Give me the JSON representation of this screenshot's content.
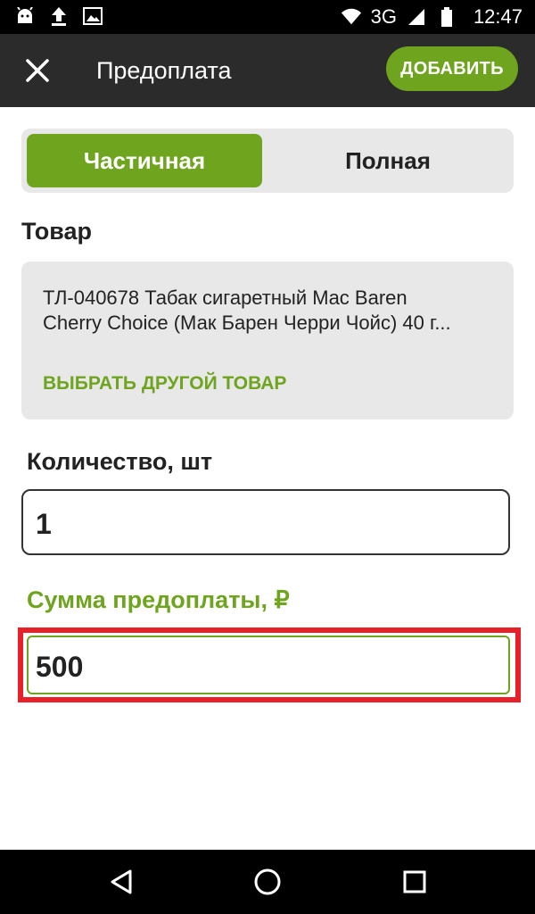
{
  "status_bar": {
    "network": "3G",
    "time": "12:47",
    "icons": [
      "android-icon",
      "upload-icon",
      "image-icon",
      "wifi-icon",
      "signal-icon",
      "battery-icon"
    ]
  },
  "app_bar": {
    "title": "Предоплата",
    "add_label": "ДОБАВИТЬ"
  },
  "segment": {
    "partial_label": "Частичная",
    "full_label": "Полная",
    "selected": "partial"
  },
  "product": {
    "section_label": "Товар",
    "name_line1": "ТЛ-040678 Табак сигаретный Mac Baren",
    "name_line2": "Cherry Choice (Мак Барен Черри Чойс) 40 г...",
    "choose_other_label": "ВЫБРАТЬ ДРУГОЙ ТОВАР"
  },
  "quantity": {
    "label": "Количество, шт",
    "value": "1"
  },
  "prepayment": {
    "label": "Сумма предоплаты, ₽",
    "value": "500"
  },
  "colors": {
    "accent": "#6fa41f",
    "highlight": "#e8202a",
    "appbar": "#2b2b2b"
  }
}
